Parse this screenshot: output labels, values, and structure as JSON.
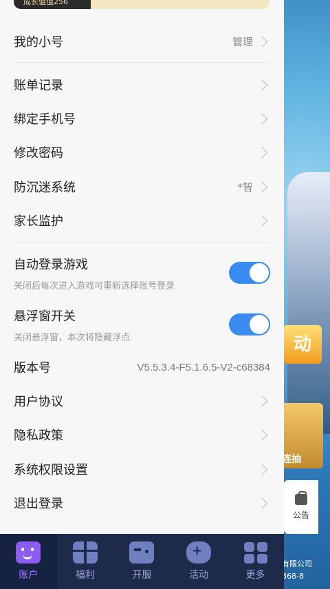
{
  "header": {
    "growth_label": "成长值值256"
  },
  "menu": {
    "my_alt": {
      "title": "我的小号",
      "hint": "管理"
    },
    "bills": {
      "title": "账单记录"
    },
    "bind_phone": {
      "title": "绑定手机号"
    },
    "change_password": {
      "title": "修改密码"
    },
    "anti_addiction": {
      "title": "防沉迷系统",
      "hint": "*智"
    },
    "parental": {
      "title": "家长监护"
    },
    "auto_login": {
      "title": "自动登录游戏",
      "subtitle": "关闭后每次进入游戏可重新选择账号登录",
      "enabled": true
    },
    "float_window": {
      "title": "悬浮窗开关",
      "subtitle": "关闭悬浮窗，本次将隐藏浮点",
      "enabled": true
    },
    "version": {
      "title": "版本号",
      "value": "V5.5.3.4-F5.1.6.5-V2-c68384"
    },
    "user_agreement": {
      "title": "用户协议"
    },
    "privacy": {
      "title": "隐私政策"
    },
    "permissions": {
      "title": "系统权限设置"
    },
    "logout": {
      "title": "退出登录"
    }
  },
  "bottom_nav": [
    {
      "label": "账户",
      "icon": "account-face-icon",
      "active": true
    },
    {
      "label": "福利",
      "icon": "gift-icon",
      "active": false
    },
    {
      "label": "开服",
      "icon": "gamepad-icon",
      "active": false
    },
    {
      "label": "活动",
      "icon": "controller-icon",
      "active": false
    },
    {
      "label": "更多",
      "icon": "grid-icon",
      "active": false
    }
  ],
  "background": {
    "notice_label": "公告",
    "banner_char": "动",
    "card_label": "连抽",
    "company_text": "有限公司",
    "license_text": "368-8"
  },
  "colors": {
    "accent": "#3a8bf0",
    "nav_bg": "#1e2a4a",
    "active_nav": "#9c7cff"
  }
}
